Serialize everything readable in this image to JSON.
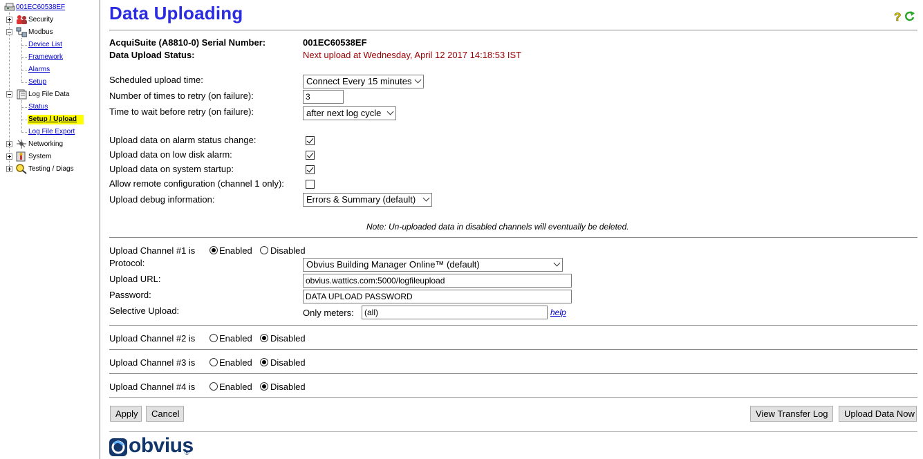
{
  "tree": {
    "root": "001EC60538EF",
    "items": [
      {
        "label": "Security"
      },
      {
        "label": "Modbus",
        "children": [
          "Device List",
          "Framework",
          "Alarms",
          "Setup"
        ]
      },
      {
        "label": "Log File Data",
        "children": [
          "Status",
          "Setup / Upload",
          "Log File Export"
        ]
      },
      {
        "label": "Networking"
      },
      {
        "label": "System"
      },
      {
        "label": "Testing / Diags"
      }
    ]
  },
  "page": {
    "title": "Data Uploading",
    "serial_label": "AcquiSuite (A8810-0) Serial Number:",
    "serial_value": "001EC60538EF",
    "status_label": "Data Upload Status:",
    "status_value": "Next upload at Wednesday, April 12 2017 14:18:53 IST"
  },
  "settings": {
    "scheduled_label": "Scheduled upload time:",
    "scheduled_value": "Connect Every 15 minutes",
    "retry_label": "Number of times to retry (on failure):",
    "retry_value": "3",
    "wait_label": "Time to wait before retry (on failure):",
    "wait_value": "after next log cycle",
    "alarm_label": "Upload data on alarm status change:",
    "alarm_checked": true,
    "lowdisk_label": "Upload data on low disk alarm:",
    "lowdisk_checked": true,
    "startup_label": "Upload data on system startup:",
    "startup_checked": true,
    "remote_label": "Allow remote configuration (channel 1 only):",
    "remote_checked": false,
    "debug_label": "Upload debug information:",
    "debug_value": "Errors & Summary (default)",
    "note": "Note: Un-uploaded data in disabled channels will eventually be deleted."
  },
  "channels": [
    {
      "label": "Upload Channel #1 is",
      "enabled_label": "Enabled",
      "disabled_label": "Disabled",
      "enabled": true,
      "protocol_label": "Protocol:",
      "protocol_value": "Obvius Building Manager Online™ (default)",
      "url_label": "Upload URL:",
      "url_value": "obvius.wattics.com:5000/logfileupload",
      "password_label": "Password:",
      "password_value": "DATA UPLOAD PASSWORD",
      "selective_label": "Selective Upload:",
      "only_meters_label": "Only meters:",
      "only_meters_value": "(all)",
      "help_label": "help"
    },
    {
      "label": "Upload Channel #2 is",
      "enabled_label": "Enabled",
      "disabled_label": "Disabled",
      "enabled": false
    },
    {
      "label": "Upload Channel #3 is",
      "enabled_label": "Enabled",
      "disabled_label": "Disabled",
      "enabled": false
    },
    {
      "label": "Upload Channel #4 is",
      "enabled_label": "Enabled",
      "disabled_label": "Disabled",
      "enabled": false
    }
  ],
  "buttons": {
    "apply": "Apply",
    "cancel": "Cancel",
    "view_log": "View Transfer Log",
    "upload_now": "Upload Data Now"
  },
  "logo": {
    "text": "obvius",
    "mark": "®"
  },
  "colors": {
    "title": "#2b2be0",
    "status": "#990000",
    "highlight": "#ffff00",
    "link": "#0000cc"
  }
}
